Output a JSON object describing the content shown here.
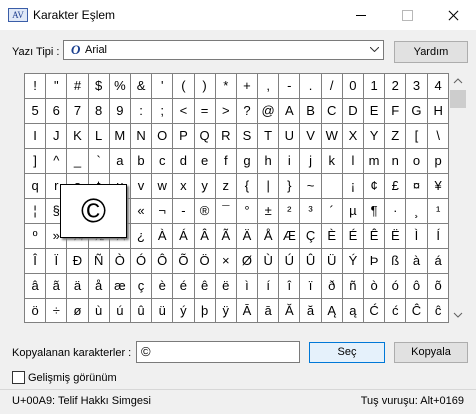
{
  "window": {
    "title": "Karakter Eşlem",
    "app_icon_text": "AV"
  },
  "font": {
    "label": "Yazı Tipi :",
    "selected": "Arial",
    "icon": "opentype-font-icon"
  },
  "help_button": "Yardım",
  "grid": {
    "rows": [
      [
        "!",
        "\"",
        "#",
        "$",
        "%",
        "&",
        "'",
        "(",
        ")",
        "*",
        "+",
        ",",
        "-",
        ".",
        "/",
        "0",
        "1",
        "2",
        "3",
        "4"
      ],
      [
        "5",
        "6",
        "7",
        "8",
        "9",
        ":",
        ";",
        "<",
        "=",
        ">",
        "?",
        "@",
        "A",
        "B",
        "C",
        "D",
        "E",
        "F",
        "G",
        "H"
      ],
      [
        "I",
        "J",
        "K",
        "L",
        "M",
        "N",
        "O",
        "P",
        "Q",
        "R",
        "S",
        "T",
        "U",
        "V",
        "W",
        "X",
        "Y",
        "Z",
        "[",
        "\\"
      ],
      [
        "]",
        "^",
        "_",
        "`",
        "a",
        "b",
        "c",
        "d",
        "e",
        "f",
        "g",
        "h",
        "i",
        "j",
        "k",
        "l",
        "m",
        "n",
        "o",
        "p"
      ],
      [
        "q",
        "r",
        "s",
        "t",
        "u",
        "v",
        "w",
        "x",
        "y",
        "z",
        "{",
        "|",
        "}",
        "~",
        "",
        "¡",
        "¢",
        "£",
        "¤",
        "¥"
      ],
      [
        "¦",
        "§",
        "¨",
        "©",
        "ª",
        "«",
        "¬",
        "-",
        "®",
        "¯",
        "°",
        "±",
        "²",
        "³",
        "´",
        "µ",
        "¶",
        "·",
        "¸",
        "¹"
      ],
      [
        "º",
        "»",
        "¼",
        "½",
        "¾",
        "¿",
        "À",
        "Á",
        "Â",
        "Ã",
        "Ä",
        "Å",
        "Æ",
        "Ç",
        "È",
        "É",
        "Ê",
        "Ë",
        "Ì",
        "Í"
      ],
      [
        "Î",
        "Ï",
        "Ð",
        "Ñ",
        "Ò",
        "Ó",
        "Ô",
        "Õ",
        "Ö",
        "×",
        "Ø",
        "Ù",
        "Ú",
        "Û",
        "Ü",
        "Ý",
        "Þ",
        "ß",
        "à",
        "á"
      ],
      [
        "â",
        "ã",
        "ä",
        "å",
        "æ",
        "ç",
        "è",
        "é",
        "ê",
        "ë",
        "ì",
        "í",
        "î",
        "ï",
        "ð",
        "ñ",
        "ò",
        "ó",
        "ô",
        "õ"
      ],
      [
        "ö",
        "÷",
        "ø",
        "ù",
        "ú",
        "û",
        "ü",
        "ý",
        "þ",
        "ÿ",
        "Ā",
        "ā",
        "Ă",
        "ă",
        "Ą",
        "ą",
        "Ć",
        "ć",
        "Ĉ",
        "ĉ"
      ]
    ],
    "zoomed_char": "©"
  },
  "copy": {
    "label": "Kopyalanan karakterler :",
    "value": "©",
    "select_button": "Seç",
    "copy_button": "Kopyala"
  },
  "advanced_view": {
    "label": "Gelişmiş görünüm",
    "checked": false
  },
  "status": {
    "left": "U+00A9: Telif Hakkı Simgesi",
    "right": "Tuş vuruşu: Alt+0169"
  }
}
